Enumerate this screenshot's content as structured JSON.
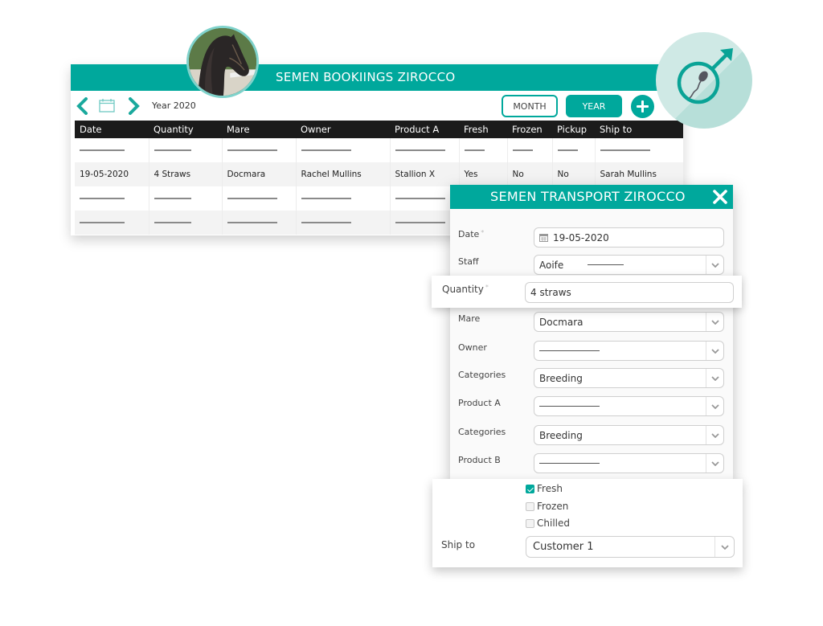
{
  "bookings": {
    "title": "SEMEN BOOKIINGS ZIROCCO",
    "period_label": "Year 2020",
    "month_button": "MONTH",
    "year_button": "YEAR",
    "columns": [
      "Date",
      "Quantity",
      "Mare",
      "Owner",
      "Product A",
      "Fresh",
      "Frozen",
      "Pickup",
      "Ship to"
    ],
    "rows": [
      {
        "placeholder": true
      },
      {
        "placeholder": false,
        "cells": [
          "19-05-2020",
          "4 Straws",
          "Docmara",
          "Rachel Mullins",
          "Stallion X",
          "Yes",
          "No",
          "No",
          "Sarah Mullins"
        ]
      },
      {
        "placeholder": true
      },
      {
        "placeholder": true
      }
    ]
  },
  "transport": {
    "title": "SEMEN TRANSPORT ZIROCCO",
    "date_label": "Date",
    "date_value": "19-05-2020",
    "staff_label": "Staff",
    "staff_value": "Aoife",
    "quantity_label": "Quantity",
    "quantity_value": "4 straws",
    "mare_label": "Mare",
    "mare_value": "Docmara",
    "owner_label": "Owner",
    "owner_value": "",
    "categories1_label": "Categories",
    "categories1_value": "Breeding",
    "product_a_label": "Product A",
    "product_a_value": "",
    "categories2_label": "Categories",
    "categories2_value": "Breeding",
    "product_b_label": "Product B",
    "product_b_value": "",
    "options": [
      {
        "label": "Fresh",
        "checked": true
      },
      {
        "label": "Frozen",
        "checked": false
      },
      {
        "label": "Chilled",
        "checked": false
      }
    ],
    "ship_to_label": "Ship to",
    "ship_to_value": "Customer 1"
  },
  "colors": {
    "accent": "#00a89c",
    "header_dark": "#1b1b1b",
    "badge_bg": "#cfe9e5"
  },
  "icons": {
    "avatar": "horse-photo",
    "badge": "male-sperm-icon",
    "prev": "chevron-left-icon",
    "next": "chevron-right-icon",
    "calendar": "calendar-icon",
    "add": "plus-icon",
    "close": "close-icon",
    "dropdown": "chevron-down-icon"
  }
}
